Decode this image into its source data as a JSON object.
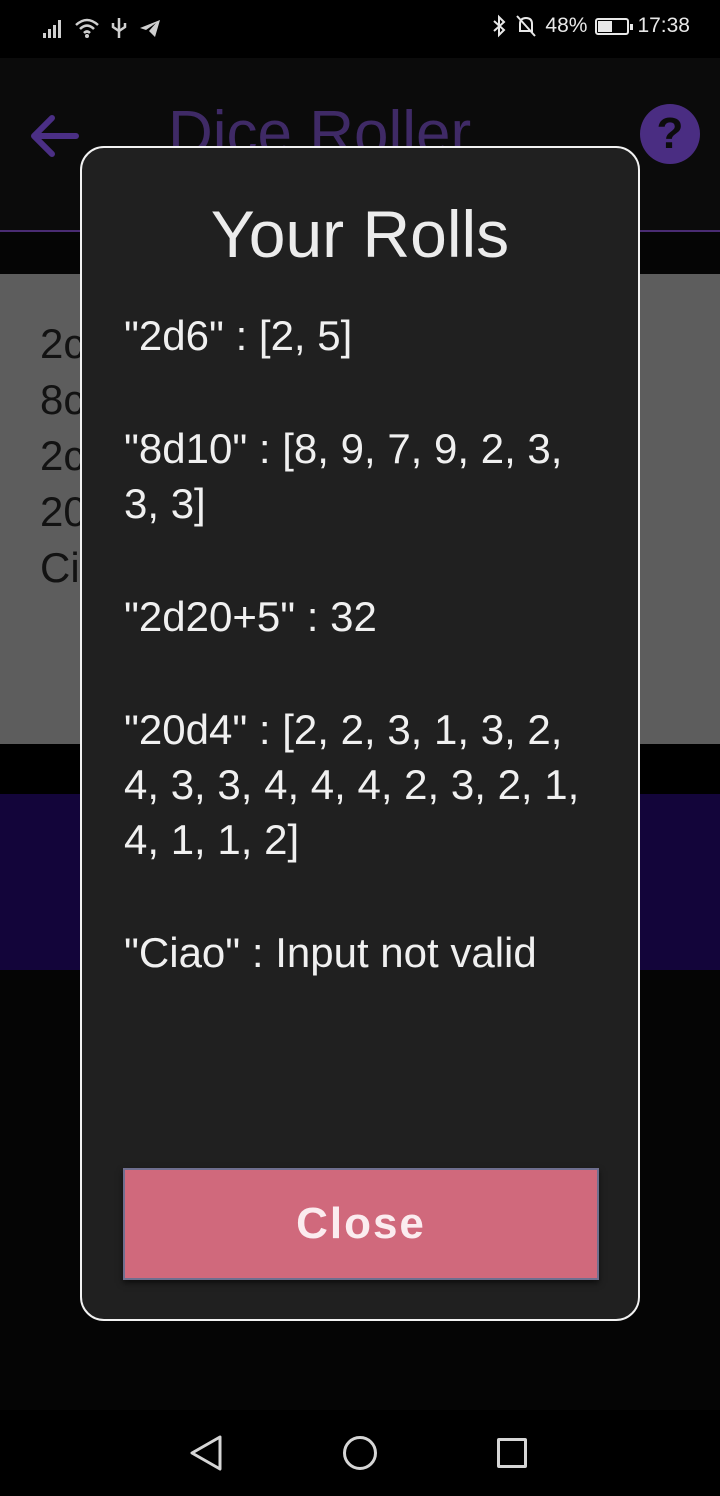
{
  "status_bar": {
    "battery": "48%",
    "battery_level": 0.48,
    "time": "17:38",
    "icons": [
      "signal-icon",
      "wifi-icon",
      "usb-icon",
      "telegram-icon",
      "bluetooth-icon",
      "mute-icon",
      "battery-icon"
    ]
  },
  "app_bar": {
    "title": "Dice Roller"
  },
  "input_area": {
    "visible_fragments": [
      "2c",
      "8c",
      "2c",
      "20",
      "Ci"
    ]
  },
  "dialog": {
    "title": "Your Rolls",
    "rolls": [
      "\"2d6\" : [2, 5]",
      "\"8d10\" : [8, 9, 7, 9, 2, 3, 3, 3]",
      "\"2d20+5\" : 32",
      "\"20d4\" : [2, 2, 3, 1, 3, 2, 4, 3, 3, 4, 4, 4, 2, 3, 2, 1, 4, 1, 1, 2]",
      "\"Ciao\" : Input not valid"
    ],
    "close_label": "Close"
  },
  "colors": {
    "dialog_bg": "#202020",
    "close_button": "#d0697c",
    "accent_purple": "#4a2d82"
  }
}
